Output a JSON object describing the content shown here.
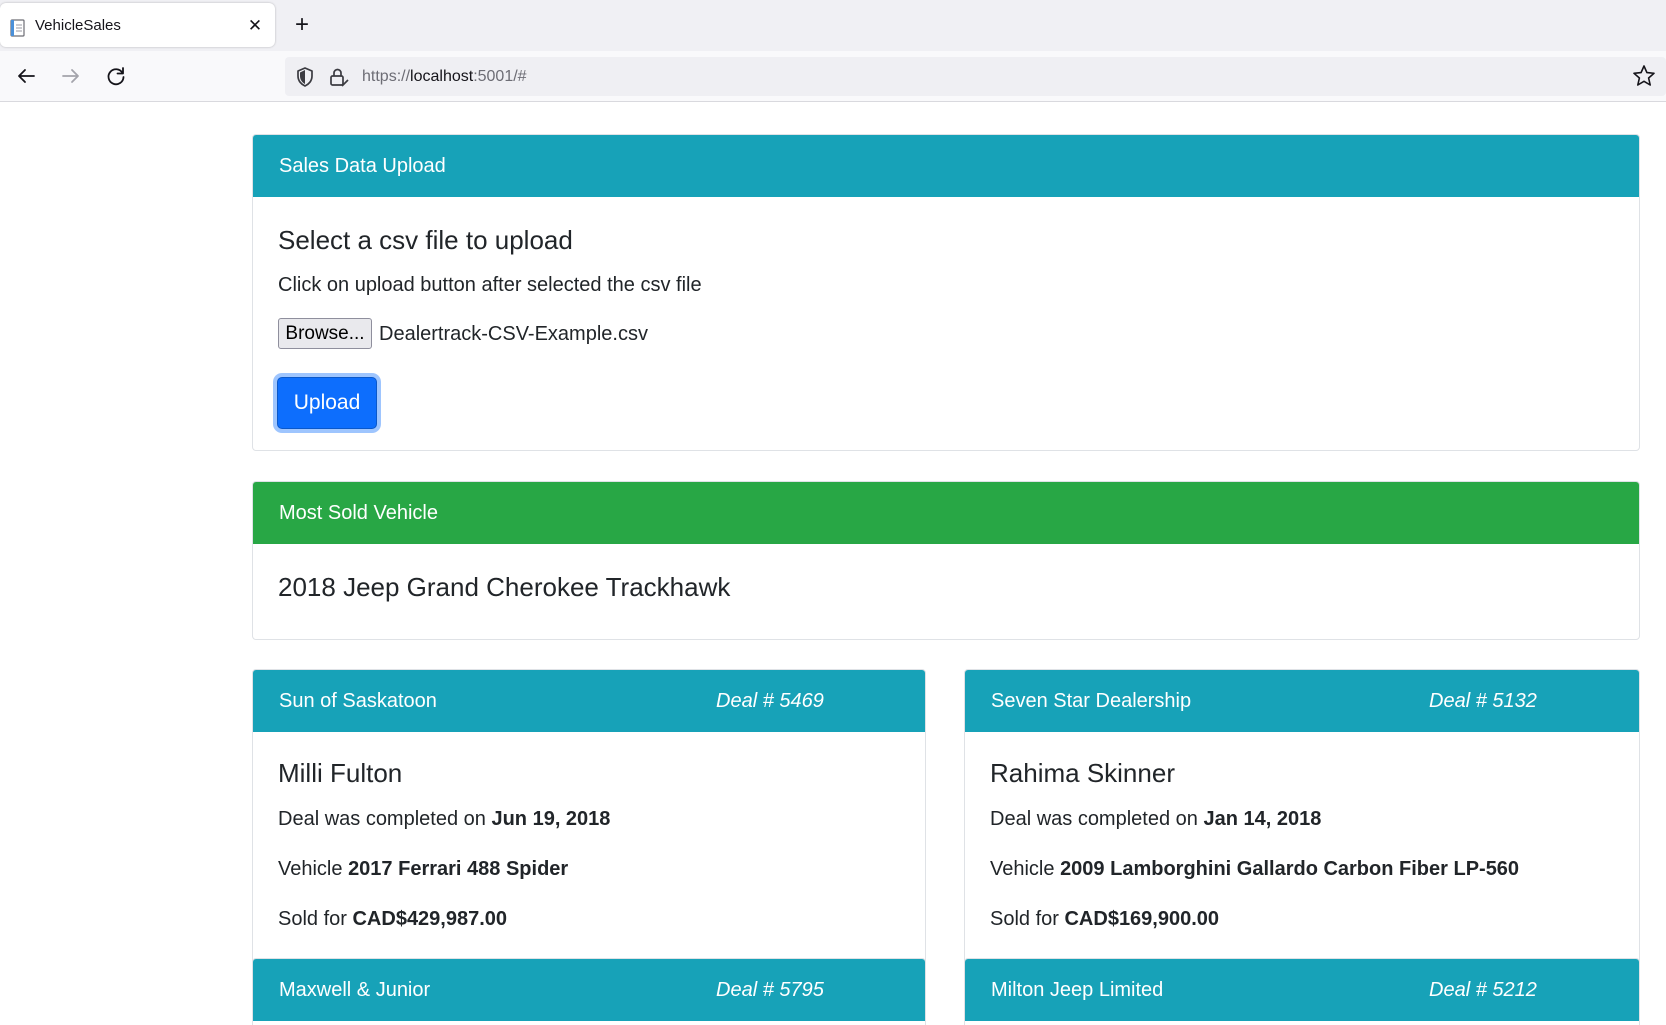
{
  "browser": {
    "tab_title": "VehicleSales",
    "new_tab_label": "+",
    "close_label": "✕",
    "url_prefix": "https://",
    "url_host": "localhost",
    "url_rest": ":5001/#"
  },
  "upload": {
    "header": "Sales Data Upload",
    "title": "Select a csv file to upload",
    "description": "Click on upload button after selected the csv file",
    "browse_label": "Browse...",
    "file_name": "Dealertrack-CSV-Example.csv",
    "upload_label": "Upload"
  },
  "most_sold": {
    "header": "Most Sold Vehicle",
    "vehicle": "2018 Jeep Grand Cherokee Trackhawk"
  },
  "deal_labels": {
    "completed": "Deal was completed on ",
    "vehicle": "Vehicle ",
    "sold": "Sold for "
  },
  "deals": [
    {
      "dealership": "Sun of Saskatoon",
      "deal_number": "Deal # 5469",
      "customer": "Milli Fulton",
      "date": "Jun 19, 2018",
      "vehicle": "2017 Ferrari 488 Spider",
      "price": "CAD$429,987.00"
    },
    {
      "dealership": "Seven Star Dealership",
      "deal_number": "Deal # 5132",
      "customer": "Rahima Skinner",
      "date": "Jan 14, 2018",
      "vehicle": "2009 Lamborghini Gallardo Carbon Fiber LP-560",
      "price": "CAD$169,900.00"
    },
    {
      "dealership": "Maxwell & Junior",
      "deal_number": "Deal # 5795"
    },
    {
      "dealership": "Milton Jeep Limited",
      "deal_number": "Deal # 5212"
    }
  ],
  "colors": {
    "info": "#17a2b8",
    "success": "#28a745",
    "primary": "#0d6efd"
  },
  "icons": [
    "document-icon",
    "close-icon",
    "plus-icon",
    "back-icon",
    "forward-icon",
    "reload-icon",
    "shield-icon",
    "lock-icon",
    "star-icon"
  ]
}
